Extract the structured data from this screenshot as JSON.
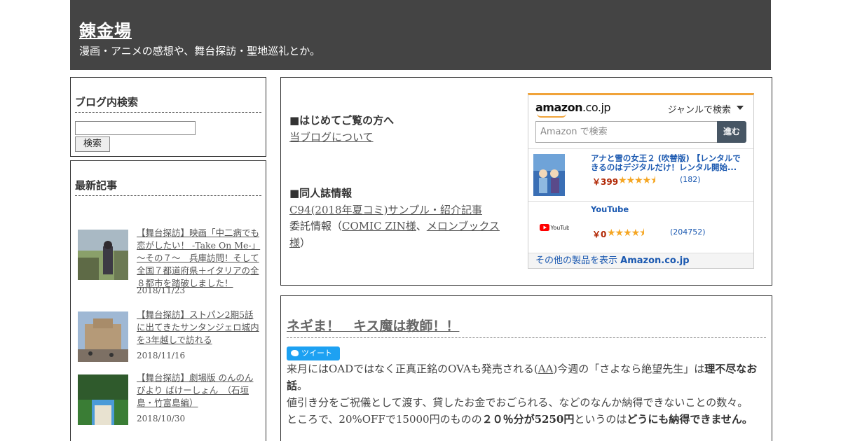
{
  "header": {
    "title": "錬金場",
    "description": "漫画・アニメの感想や、舞台探訪・聖地巡礼とか。"
  },
  "search_widget": {
    "title": "ブログ内検索",
    "input_value": "",
    "button_label": "検索"
  },
  "recent_posts": {
    "title": "最新記事",
    "items": [
      {
        "title": "【舞台探訪】映画「中二病でも恋がしたい！ -Take On Me-」～その７～　兵庫訪問！そして全国７都道府県＋イタリアの全８都市を踏破しました！",
        "date": "2018/11/23"
      },
      {
        "title": "【舞台探訪】ストパン2期5話に出てきたサンタンジェロ城内を3年越しで訪れる",
        "date": "2018/11/16"
      },
      {
        "title": "【舞台探訪】劇場版 のんのんびより ばけーしょん　（石垣島・竹富島編）",
        "date": "2018/10/30"
      }
    ]
  },
  "info": {
    "first_visit_heading": "■はじめてご覧の方へ",
    "about_link": "当ブログについて",
    "doujin_heading": "■同人誌情報",
    "c94_link": "C94(2018年夏コミ)サンプル・紹介記事",
    "consign_prefix": "委託情報（",
    "comic_zin_link": "COMIC ZIN様",
    "separator": "、",
    "melon_link": "メロンブックス様",
    "consign_suffix": "）"
  },
  "amazon": {
    "logo_text": "amazon",
    "logo_suffix": ".co.jp",
    "genre_label": "ジャンルで検索",
    "search_placeholder": "Amazon で検索",
    "search_button": "進む",
    "items": [
      {
        "title": "アナと雪の女王２ (吹替版) 【レンタルできるのはデジタルだけ！レンタル開始...",
        "price": "￥399",
        "stars": "★★★★⯨",
        "rating": 4.5,
        "count": "(182)",
        "icon": "frozen2-cover"
      },
      {
        "title": "YouTube",
        "price": "￥0",
        "stars": "★★★★⯨",
        "rating": 4.5,
        "count": "(204752)",
        "icon": "youtube-logo"
      }
    ],
    "footer_prefix": "その他の製品を表示 ",
    "footer_brand": "Amazon.co.jp"
  },
  "article": {
    "title": "ネギま！　キス魔は教師！！",
    "tweet_label": "ツイート",
    "p1_a": "来月にはOADではなく正真正銘のOVAも発売される(",
    "p1_link": "AA",
    "p1_b": ")今週の「さよなら絶望先生」は",
    "p1_bold": "理不尽なお話",
    "p1_c": "。",
    "p2": "値引き分をご祝儀として渡す、貸したお金でおごられる、などのなんか納得できないことの数々。",
    "p3_a": "ところで、20%OFFで15000円のものの",
    "p3_bold1": "２０％分が5250円",
    "p3_b": "というのは",
    "p3_bold2": "どうにも納得できません。"
  },
  "colors": {
    "header_bg": "#444444",
    "amazon_orange": "#f0a33a",
    "amazon_link": "#1a58b0",
    "price_red": "#b12704",
    "twitter_blue": "#1da1f2"
  }
}
